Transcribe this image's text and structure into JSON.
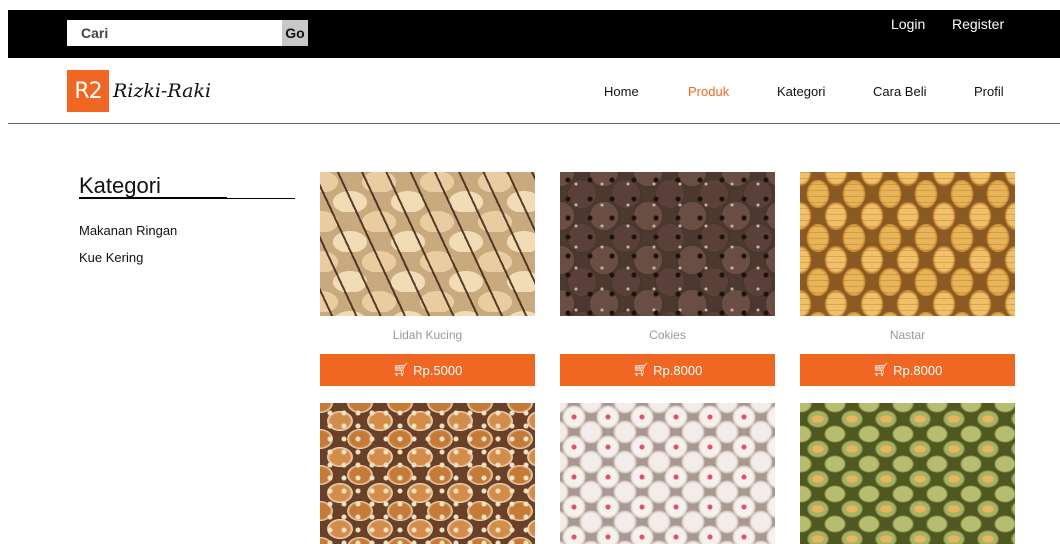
{
  "topbar": {
    "search_placeholder": "Cari",
    "search_button": "Go",
    "login": "Login",
    "register": "Register"
  },
  "header": {
    "logo_mark": "R2",
    "logo_text": "Rizki-Raki",
    "nav": [
      "Home",
      "Produk",
      "Kategori",
      "Cara Beli",
      "Profil"
    ],
    "active_nav": "Produk"
  },
  "sidebar": {
    "title": "Kategori",
    "items": [
      "Makanan Ringan",
      "Kue Kering"
    ]
  },
  "products": [
    {
      "name": "Lidah Kucing",
      "price": "Rp.5000",
      "image": "lidah-kucing-cookies"
    },
    {
      "name": "Cokies",
      "price": "Rp.8000",
      "image": "chocolate-cookies"
    },
    {
      "name": "Nastar",
      "price": "Rp.8000",
      "image": "nastar-cookies"
    },
    {
      "name": "",
      "price": "",
      "image": "peanut-cookies"
    },
    {
      "name": "",
      "price": "",
      "image": "flower-cookies"
    },
    {
      "name": "",
      "price": "",
      "image": "kastengel-cookies"
    }
  ],
  "icons": {
    "cart": "cart-icon"
  },
  "colors": {
    "accent": "#ef6722",
    "topbar": "#000000"
  }
}
